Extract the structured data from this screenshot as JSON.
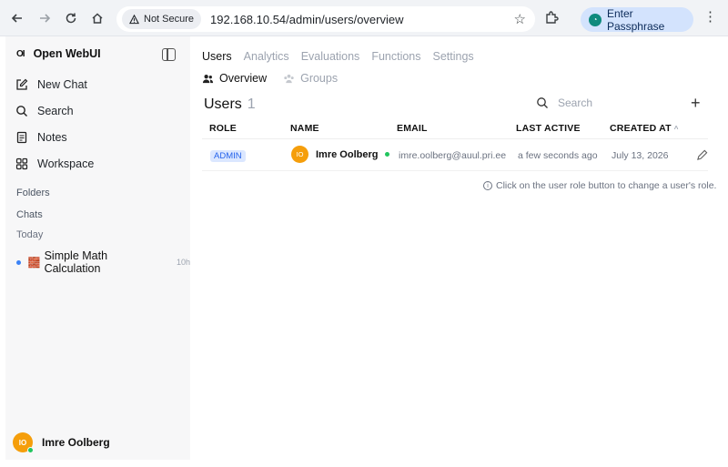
{
  "browser": {
    "security_label": "Not Secure",
    "url": "192.168.10.54/admin/users/overview",
    "passphrase_button": "Enter Passphrase"
  },
  "sidebar": {
    "app_name": "Open WebUI",
    "logo_text": "OI",
    "menu": [
      {
        "label": "New Chat",
        "icon": "pencil-square-icon"
      },
      {
        "label": "Search",
        "icon": "search-icon"
      },
      {
        "label": "Notes",
        "icon": "notes-icon"
      },
      {
        "label": "Workspace",
        "icon": "grid-icon"
      }
    ],
    "folders_label": "Folders",
    "chats_label": "Chats",
    "today_label": "Today",
    "chats": [
      {
        "emoji": "🧱",
        "title": "Simple Math Calculation",
        "time": "10h"
      }
    ],
    "user": {
      "initials": "IO",
      "name": "Imre Oolberg"
    }
  },
  "main": {
    "tabs": [
      "Users",
      "Analytics",
      "Evaluations",
      "Functions",
      "Settings"
    ],
    "subtabs": [
      "Overview",
      "Groups"
    ],
    "title": "Users",
    "count": "1",
    "search_placeholder": "Search",
    "columns": [
      "ROLE",
      "NAME",
      "EMAIL",
      "LAST ACTIVE",
      "CREATED AT"
    ],
    "sort_indicator": "^",
    "rows": [
      {
        "role": "ADMIN",
        "initials": "IO",
        "name": "Imre Oolberg",
        "email": "imre.oolberg@auul.pri.ee",
        "last_active": "a few seconds ago",
        "created_at": "July 13, 2026"
      }
    ],
    "hint": "Click on the user role button to change a user's role."
  },
  "colors": {
    "accent": "#2563eb",
    "avatar": "#f59e0b",
    "online": "#22c55e",
    "passphrase_bg": "#d3e3fd"
  }
}
